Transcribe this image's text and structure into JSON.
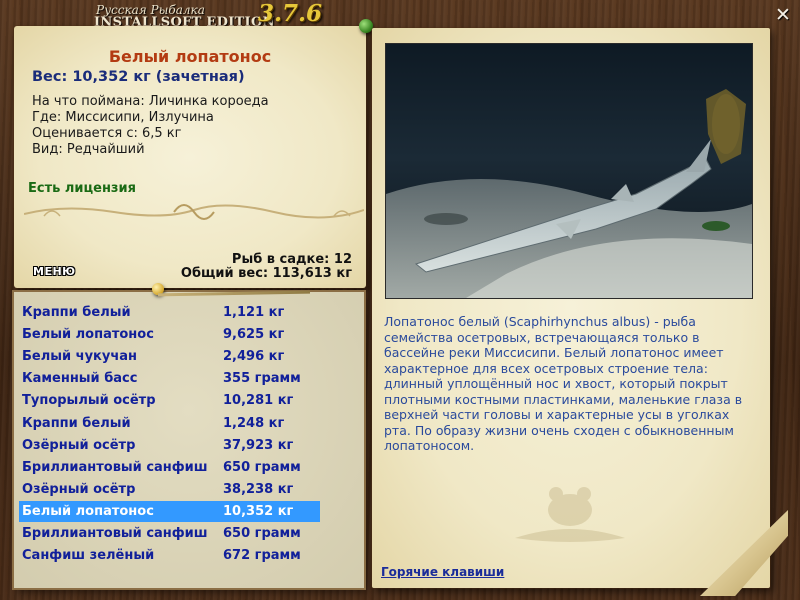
{
  "header": {
    "title_line1": "Русская Рыбалка",
    "title_line2": "INSTALLSOFT EDITION",
    "version": "3.7.6",
    "close_symbol": "✕"
  },
  "catch": {
    "fish_name": "Белый лопатонос",
    "weight": "Вес: 10,352 кг (зачетная)",
    "bait": "На что поймана: Личинка короеда",
    "location": "Где: Миссисипи, Излучина",
    "min_weight": "Оценивается с: 6,5 кг",
    "rarity": "Вид: Редчайший",
    "license": "Есть лицензия"
  },
  "cage": {
    "count": "Рыб в садке: 12",
    "total_weight": "Общий вес: 113,613 кг"
  },
  "menu_label": "МЕНЮ",
  "fish_list": [
    {
      "name": "Краппи белый",
      "weight": "1,121 кг"
    },
    {
      "name": "Белый лопатонос",
      "weight": "9,625 кг"
    },
    {
      "name": "Белый чукучан",
      "weight": "2,496 кг"
    },
    {
      "name": "Каменный басс",
      "weight": "355 грамм"
    },
    {
      "name": "Тупорылый осётр",
      "weight": "10,281 кг"
    },
    {
      "name": "Краппи белый",
      "weight": "1,248 кг"
    },
    {
      "name": "Озёрный осётр",
      "weight": "37,923 кг"
    },
    {
      "name": "Бриллиантовый санфиш",
      "weight": "650 грамм"
    },
    {
      "name": "Озёрный осётр",
      "weight": "38,238 кг"
    },
    {
      "name": "Белый лопатонос",
      "weight": "10,352 кг"
    },
    {
      "name": "Бриллиантовый санфиш",
      "weight": "650 грамм"
    },
    {
      "name": "Санфиш зелёный",
      "weight": "672 грамм"
    }
  ],
  "selected_index": 9,
  "description": "Лопатонос белый (Scaphirhynchus albus) - рыба семейства осетровых, встречающаяся только в бассейне реки Миссисипи. Белый лопатонос имеет характерное для всех осетровых строение тела: длинный уплощённый нос и хвост, который покрыт плотными костными пластинками, маленькие глаза в верхней части головы и характерные усы в уголках рта. По образу жизни очень сходен с обыкновенным лопатоносом.",
  "hotkeys_label": "Горячие клавиши",
  "colors": {
    "fish_name": "#b33b12",
    "weight": "#1a2c7a",
    "license": "#1a6a14",
    "list_text": "#11209a",
    "selected_bg": "#3399ff",
    "description": "#2a4a9c"
  }
}
